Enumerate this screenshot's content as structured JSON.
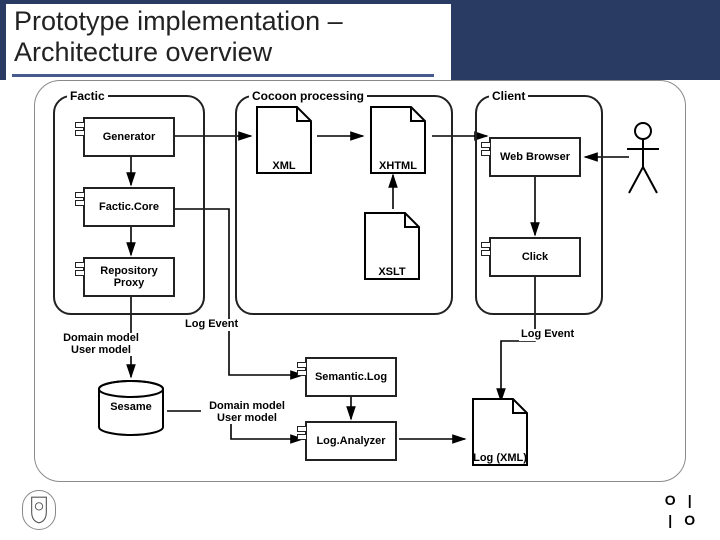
{
  "title": "Prototype implementation – Architecture overview",
  "frames": {
    "factic": "Factic",
    "cocoon": "Cocoon processing",
    "client": "Client"
  },
  "components": {
    "generator": "Generator",
    "facticcore": "Factic.Core",
    "repoproxy": "Repository Proxy",
    "semanticlog": "Semantic.Log",
    "loganalyzer": "Log.Analyzer",
    "webbrowser": "Web Browser",
    "click": "Click"
  },
  "docs": {
    "xml": "XML",
    "xhtml": "XHTML",
    "xslt": "XSLT",
    "logxml": "Log (XML)"
  },
  "cyl": {
    "sesame": "Sesame"
  },
  "labels": {
    "logevent1": "Log Event",
    "logevent2": "Log Event",
    "domainuser1": "Domain model\nUser model",
    "domainuser2": "Domain model\nUser model"
  },
  "footer": {
    "brsq": "O|IO"
  }
}
